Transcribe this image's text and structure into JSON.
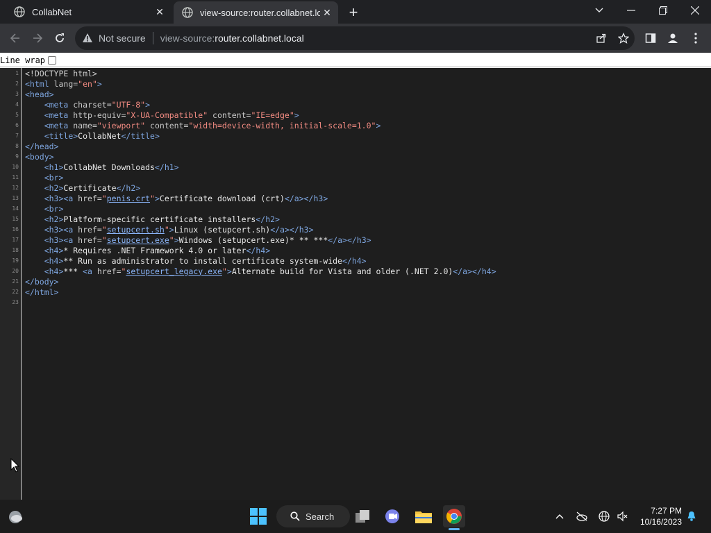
{
  "browser": {
    "tabs": [
      {
        "title": "CollabNet",
        "active": false
      },
      {
        "title": "view-source:router.collabnet.loca",
        "active": true
      }
    ],
    "omnibox": {
      "security_text": "Not secure",
      "url_prefix": "view-source:",
      "url_host": "router.collabnet.local"
    }
  },
  "page": {
    "line_wrap_label": "Line wrap",
    "line_wrap_checked": false,
    "line_numbers": [
      "1",
      "2",
      "3",
      "4",
      "5",
      "6",
      "7",
      "8",
      "9",
      "10",
      "11",
      "12",
      "13",
      "14",
      "15",
      "16",
      "17",
      "18",
      "19",
      "20",
      "21",
      "22",
      "23"
    ],
    "source": [
      {
        "indent": "",
        "tokens": [
          [
            "dt",
            "<!DOCTYPE html>"
          ]
        ]
      },
      {
        "indent": "",
        "tokens": [
          [
            "tg",
            "<html "
          ],
          [
            "at",
            "lang="
          ],
          [
            "av",
            "\"en\""
          ],
          [
            "tg",
            ">"
          ]
        ]
      },
      {
        "indent": "",
        "tokens": [
          [
            "tg",
            "<head>"
          ]
        ]
      },
      {
        "indent": "    ",
        "tokens": [
          [
            "tg",
            "<meta "
          ],
          [
            "at",
            "charset="
          ],
          [
            "av",
            "\"UTF-8\""
          ],
          [
            "tg",
            ">"
          ]
        ]
      },
      {
        "indent": "    ",
        "tokens": [
          [
            "tg",
            "<meta "
          ],
          [
            "at",
            "http-equiv="
          ],
          [
            "av",
            "\"X-UA-Compatible\""
          ],
          [
            "at",
            " content="
          ],
          [
            "av",
            "\"IE=edge\""
          ],
          [
            "tg",
            ">"
          ]
        ]
      },
      {
        "indent": "    ",
        "tokens": [
          [
            "tg",
            "<meta "
          ],
          [
            "at",
            "name="
          ],
          [
            "av",
            "\"viewport\""
          ],
          [
            "at",
            " content="
          ],
          [
            "av",
            "\"width=device-width, initial-scale=1.0\""
          ],
          [
            "tg",
            ">"
          ]
        ]
      },
      {
        "indent": "    ",
        "tokens": [
          [
            "tg",
            "<title>"
          ],
          [
            "tx",
            "CollabNet"
          ],
          [
            "tg",
            "</title>"
          ]
        ]
      },
      {
        "indent": "",
        "tokens": [
          [
            "tg",
            "</head>"
          ]
        ]
      },
      {
        "indent": "",
        "tokens": [
          [
            "tg",
            "<body>"
          ]
        ]
      },
      {
        "indent": "    ",
        "tokens": [
          [
            "tg",
            "<h1>"
          ],
          [
            "tx",
            "CollabNet Downloads"
          ],
          [
            "tg",
            "</h1>"
          ]
        ]
      },
      {
        "indent": "    ",
        "tokens": [
          [
            "tg",
            "<br>"
          ]
        ]
      },
      {
        "indent": "    ",
        "tokens": [
          [
            "tg",
            "<h2>"
          ],
          [
            "tx",
            "Certificate"
          ],
          [
            "tg",
            "</h2>"
          ]
        ]
      },
      {
        "indent": "    ",
        "tokens": [
          [
            "tg",
            "<h3><a "
          ],
          [
            "at",
            "href="
          ],
          [
            "av",
            "\""
          ],
          [
            "lk",
            "penis.crt"
          ],
          [
            "av",
            "\""
          ],
          [
            "tg",
            ">"
          ],
          [
            "tx",
            "Certificate download (crt)"
          ],
          [
            "tg",
            "</a></h3>"
          ]
        ]
      },
      {
        "indent": "    ",
        "tokens": [
          [
            "tg",
            "<br>"
          ]
        ]
      },
      {
        "indent": "    ",
        "tokens": [
          [
            "tg",
            "<h2>"
          ],
          [
            "tx",
            "Platform-specific certificate installers"
          ],
          [
            "tg",
            "</h2>"
          ]
        ]
      },
      {
        "indent": "    ",
        "tokens": [
          [
            "tg",
            "<h3><a "
          ],
          [
            "at",
            "href="
          ],
          [
            "av",
            "\""
          ],
          [
            "lk",
            "setupcert.sh"
          ],
          [
            "av",
            "\""
          ],
          [
            "tg",
            ">"
          ],
          [
            "tx",
            "Linux (setupcert.sh)"
          ],
          [
            "tg",
            "</a></h3>"
          ]
        ]
      },
      {
        "indent": "    ",
        "tokens": [
          [
            "tg",
            "<h3><a "
          ],
          [
            "at",
            "href="
          ],
          [
            "av",
            "\""
          ],
          [
            "lk",
            "setupcert.exe"
          ],
          [
            "av",
            "\""
          ],
          [
            "tg",
            ">"
          ],
          [
            "tx",
            "Windows (setupcert.exe)* ** ***"
          ],
          [
            "tg",
            "</a></h3>"
          ]
        ]
      },
      {
        "indent": "    ",
        "tokens": [
          [
            "tg",
            "<h4>"
          ],
          [
            "tx",
            "* Requires .NET Framework 4.0 or later"
          ],
          [
            "tg",
            "</h4>"
          ]
        ]
      },
      {
        "indent": "    ",
        "tokens": [
          [
            "tg",
            "<h4>"
          ],
          [
            "tx",
            "** Run as administrator to install certificate system-wide"
          ],
          [
            "tg",
            "</h4>"
          ]
        ]
      },
      {
        "indent": "    ",
        "tokens": [
          [
            "tg",
            "<h4>"
          ],
          [
            "tx",
            "*** "
          ],
          [
            "tg",
            "<a "
          ],
          [
            "at",
            "href="
          ],
          [
            "av",
            "\""
          ],
          [
            "lk",
            "setupcert_legacy.exe"
          ],
          [
            "av",
            "\""
          ],
          [
            "tg",
            ">"
          ],
          [
            "tx",
            "Alternate build for Vista and older (.NET 2.0)"
          ],
          [
            "tg",
            "</a></h4>"
          ]
        ]
      },
      {
        "indent": "",
        "tokens": [
          [
            "tg",
            "</body>"
          ]
        ]
      },
      {
        "indent": "",
        "tokens": [
          [
            "tg",
            "</html>"
          ]
        ]
      },
      {
        "indent": "",
        "tokens": []
      }
    ]
  },
  "taskbar": {
    "search_label": "Search",
    "time": "7:27 PM",
    "date": "10/16/2023"
  }
}
